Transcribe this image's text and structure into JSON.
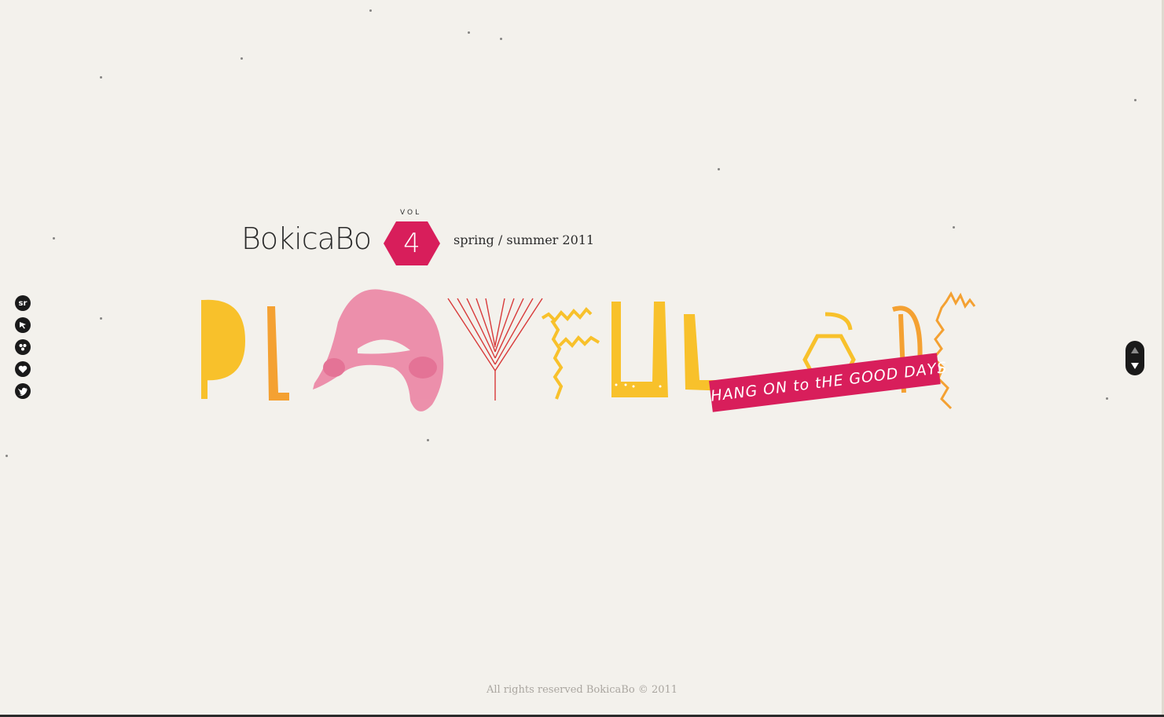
{
  "header": {
    "brand": "BokicaBo",
    "vol_label": "VOL",
    "vol_number": "4",
    "season": "spring / summer 2011"
  },
  "hero": {
    "tagline": "HANG ON to tHE GOOD DAYS"
  },
  "social": {
    "items": [
      {
        "name": "sr",
        "label": "sr"
      },
      {
        "name": "pointer-icon"
      },
      {
        "name": "flickr-icon"
      },
      {
        "name": "heart-icon"
      },
      {
        "name": "twitter-icon"
      }
    ]
  },
  "footer": {
    "copyright": "All rights reserved BokicaBo © 2011"
  },
  "colors": {
    "background": "#f3f1ec",
    "accent": "#d81e5b",
    "yellow": "#f8c12b",
    "orange": "#f4a132",
    "pink": "#ea6f96",
    "red_line": "#d83a3a"
  }
}
